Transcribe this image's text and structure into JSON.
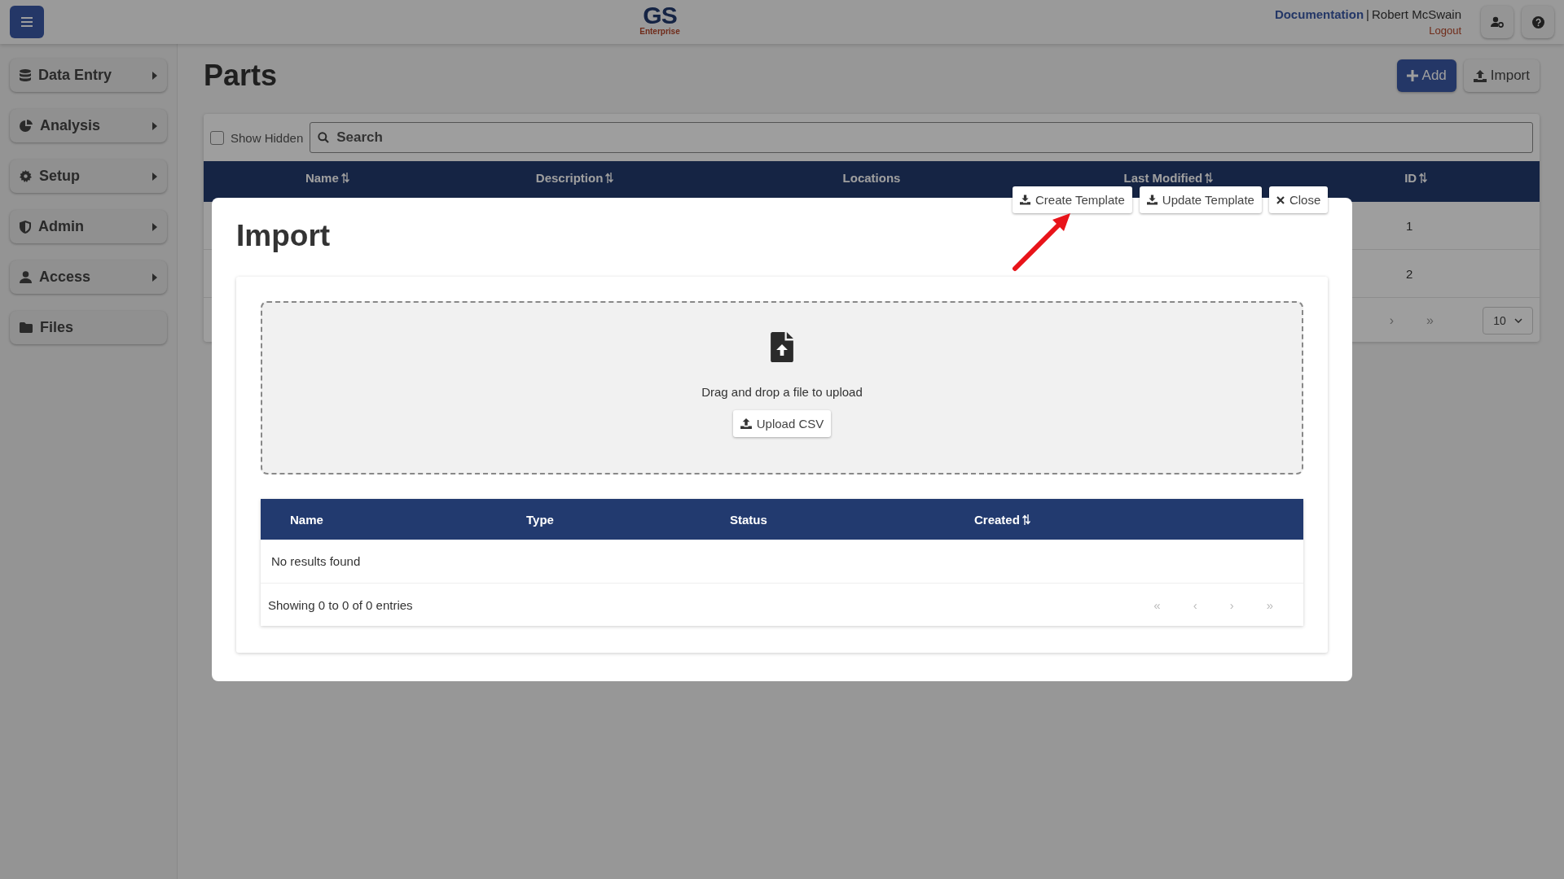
{
  "header": {
    "logo": "GS",
    "logo_sub": "Enterprise",
    "doc_link": "Documentation",
    "separator": "|",
    "user": "Robert McSwain",
    "logout": "Logout"
  },
  "sidebar": {
    "items": [
      {
        "label": "Data Entry",
        "submenu": true
      },
      {
        "label": "Analysis",
        "submenu": true
      },
      {
        "label": "Setup",
        "submenu": true
      },
      {
        "label": "Admin",
        "submenu": true
      },
      {
        "label": "Access",
        "submenu": true
      },
      {
        "label": "Files",
        "submenu": false
      }
    ]
  },
  "page": {
    "title": "Parts",
    "buttons": [
      {
        "label": "Add",
        "kind": "primary"
      },
      {
        "label": "Import",
        "kind": "default"
      }
    ]
  },
  "filter": {
    "show_hidden": {
      "label": "Show Hidden",
      "checked": false
    },
    "search": {
      "placeholder": "Search"
    }
  },
  "table": {
    "columns": [
      {
        "label": "Name",
        "sortable": true
      },
      {
        "label": "Description",
        "sortable": true
      },
      {
        "label": "Locations",
        "sortable": false
      },
      {
        "label": "Last Modified",
        "sortable": true
      },
      {
        "label": "ID",
        "sortable": true
      }
    ],
    "rows": [
      {
        "id": "1"
      },
      {
        "id": "2"
      }
    ],
    "pager": [
      "›",
      "»"
    ],
    "page_size": "10"
  },
  "dialog": {
    "title": "Import",
    "toolbar": [
      {
        "label": "Create Template",
        "kind": "download"
      },
      {
        "label": "Update Template",
        "kind": "download"
      },
      {
        "label": "Close",
        "kind": "close"
      }
    ],
    "dropzone": {
      "text": "Drag and drop a file to upload",
      "button": "Upload CSV"
    },
    "table": {
      "columns": [
        {
          "label": "Name",
          "sortable": false
        },
        {
          "label": "Type",
          "sortable": false
        },
        {
          "label": "Status",
          "sortable": false
        },
        {
          "label": "Created",
          "sortable": true
        }
      ],
      "empty": "No results found",
      "summary": "Showing 0 to 0 of 0 entries",
      "pager": [
        "«",
        "‹",
        "›",
        "»"
      ]
    }
  }
}
